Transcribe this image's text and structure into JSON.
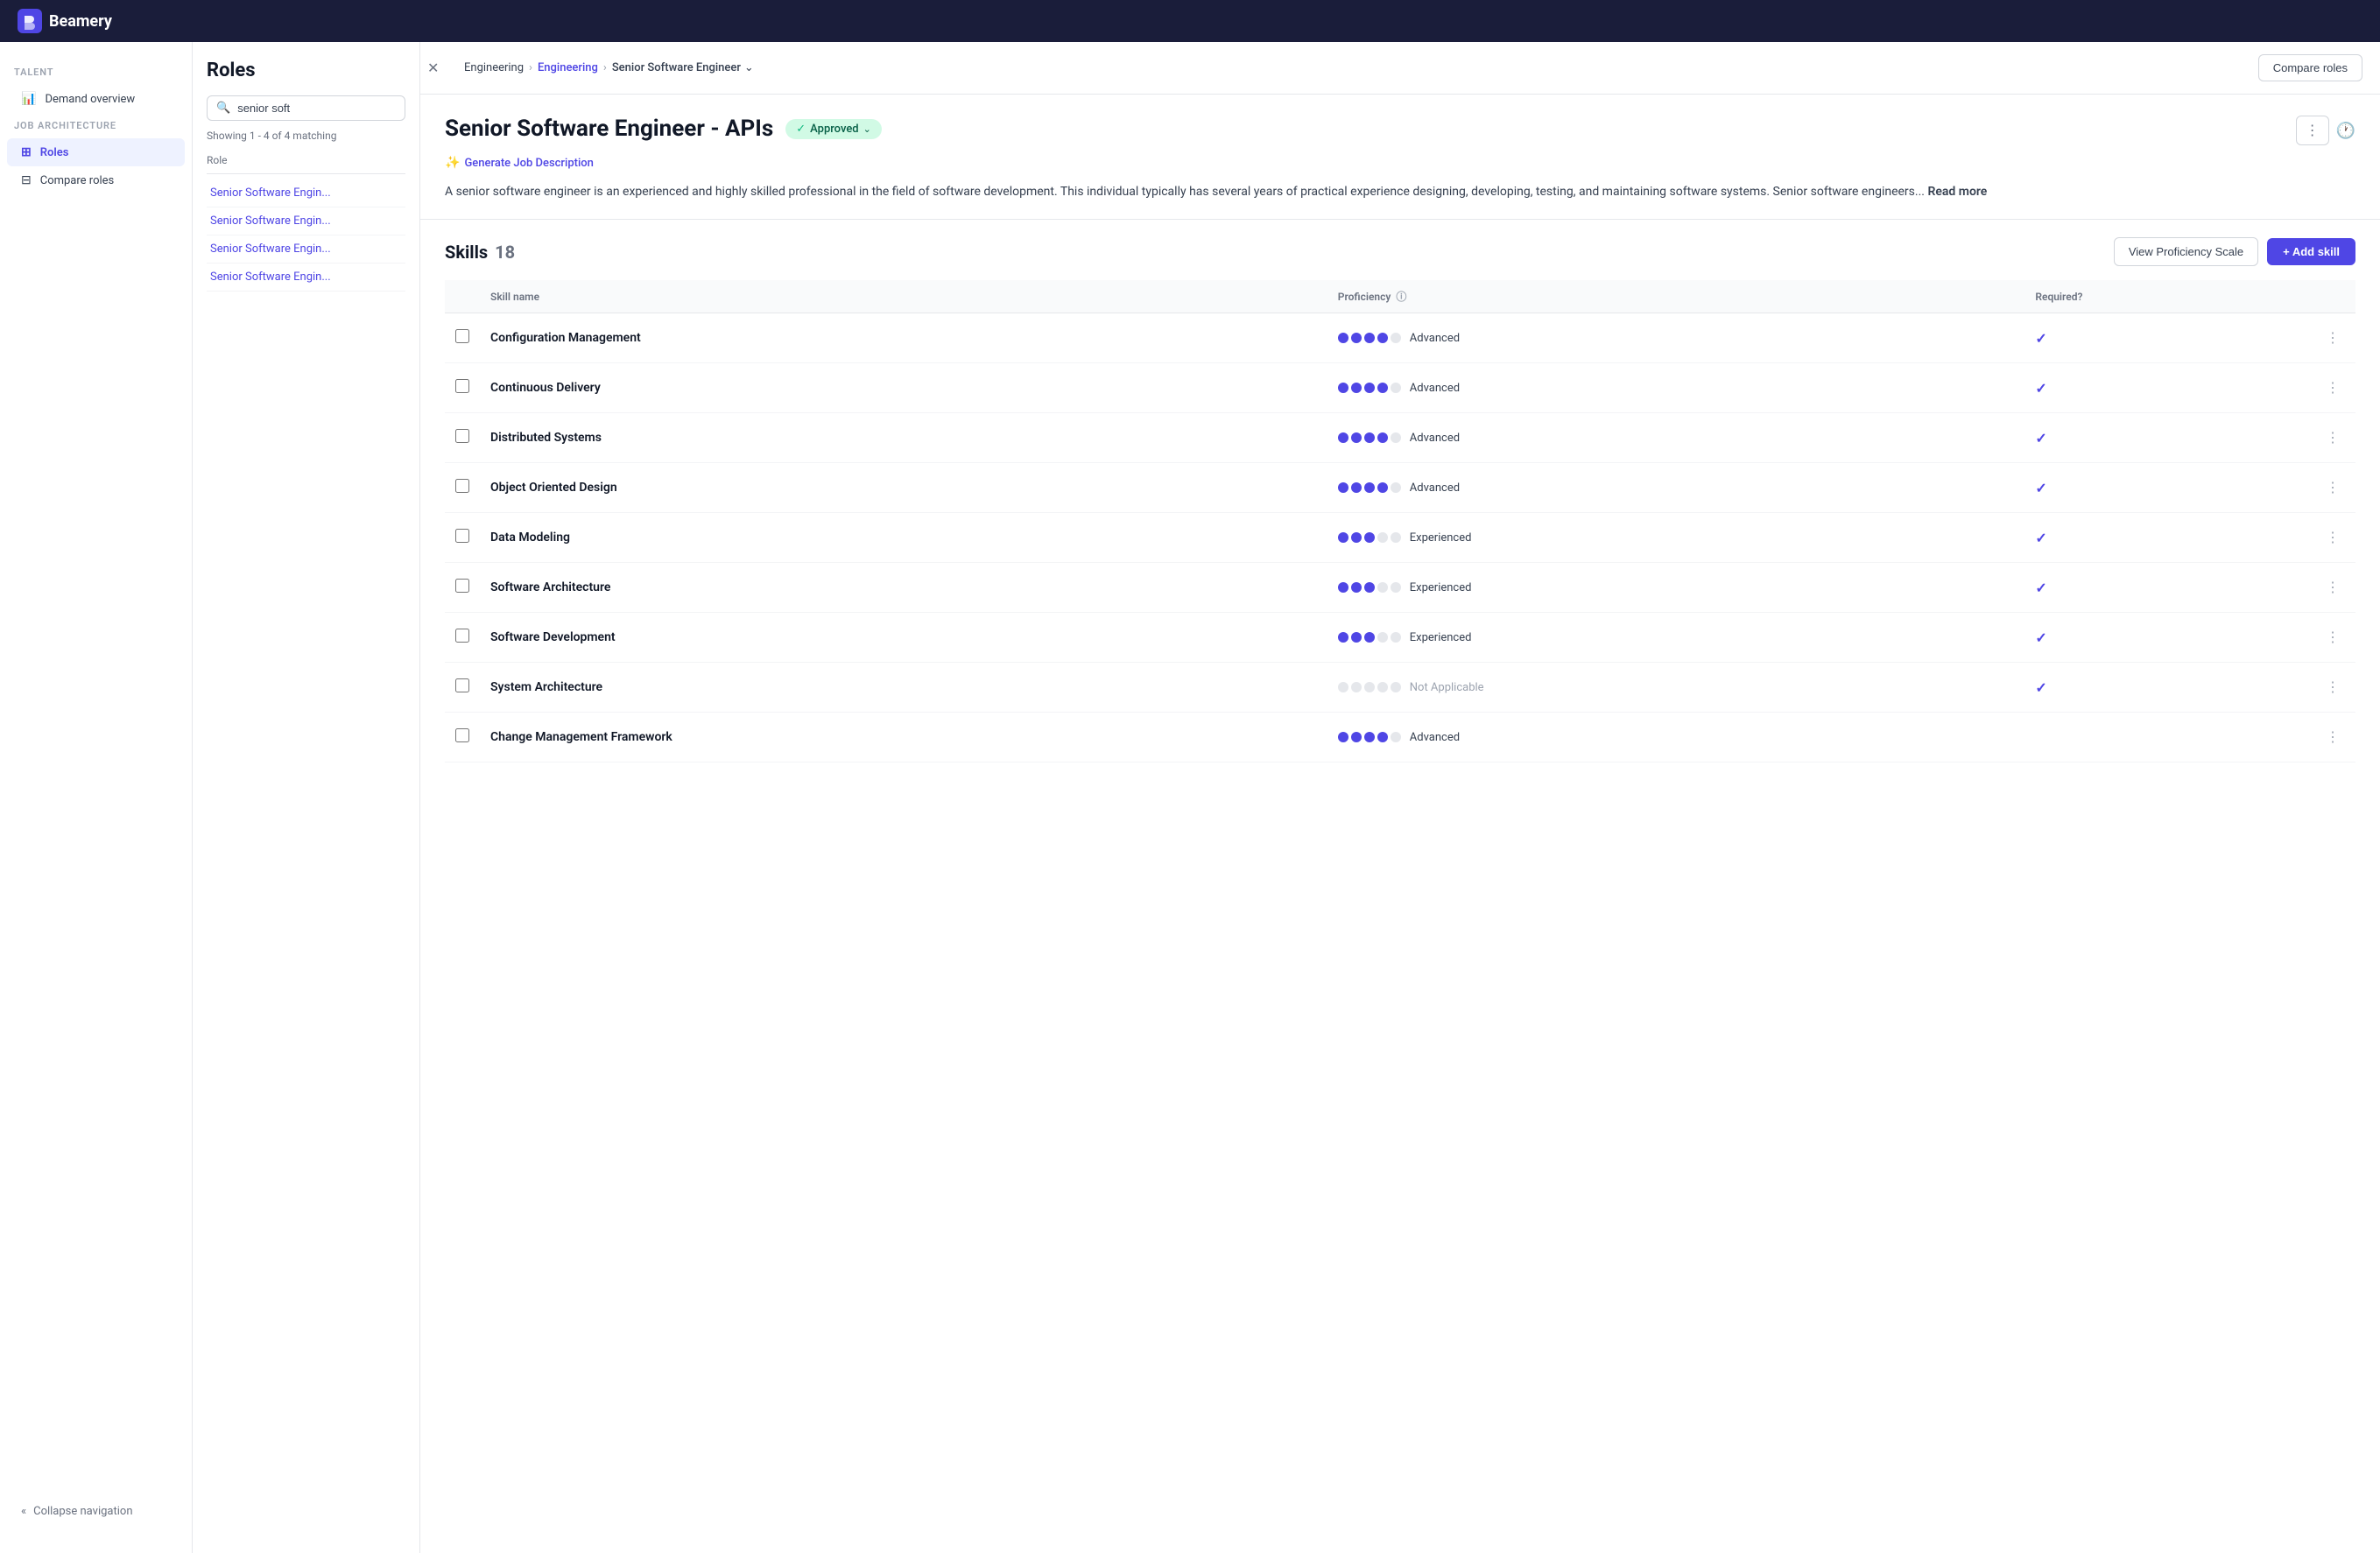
{
  "topnav": {
    "logo_text": "Beamery"
  },
  "sidebar": {
    "talent_label": "TALENT",
    "demand_overview_label": "Demand overview",
    "job_architecture_label": "JOB ARCHITECTURE",
    "roles_label": "Roles",
    "compare_roles_label": "Compare roles",
    "collapse_label": "Collapse navigation"
  },
  "roles_panel": {
    "title": "Roles",
    "search_placeholder": "senior soft",
    "search_value": "senior soft",
    "showing_text": "Showing 1 - 4 of 4 matching",
    "column_header": "Role",
    "items": [
      "Senior Software Engin...",
      "Senior Software Engin...",
      "Senior Software Engin...",
      "Senior Software Engin..."
    ]
  },
  "breadcrumb": {
    "part1": "Engineering",
    "part2": "Engineering",
    "part3": "Senior Software Engineer",
    "compare_roles": "Compare roles"
  },
  "detail": {
    "title": "Senior Software Engineer - APIs",
    "approved_label": "Approved",
    "generate_label": "Generate Job Description",
    "description": "A senior software engineer is an experienced and highly skilled professional in the field of software development. This individual typically has several years of practical experience designing, developing, testing, and maintaining software systems. Senior software engineers...",
    "read_more": "Read more",
    "skills_label": "Skills",
    "skills_count": "18",
    "view_proficiency": "View Proficiency Scale",
    "add_skill": "+ Add skill"
  },
  "skills_table": {
    "col_skill": "Skill name",
    "col_proficiency": "Proficiency",
    "col_required": "Required?",
    "rows": [
      {
        "name": "Configuration Management",
        "dots": [
          1,
          1,
          1,
          1,
          0
        ],
        "proficiency": "Advanced",
        "required": true
      },
      {
        "name": "Continuous Delivery",
        "dots": [
          1,
          1,
          1,
          1,
          0
        ],
        "proficiency": "Advanced",
        "required": true
      },
      {
        "name": "Distributed Systems",
        "dots": [
          1,
          1,
          1,
          1,
          0
        ],
        "proficiency": "Advanced",
        "required": true
      },
      {
        "name": "Object Oriented Design",
        "dots": [
          1,
          1,
          1,
          1,
          0
        ],
        "proficiency": "Advanced",
        "required": true
      },
      {
        "name": "Data Modeling",
        "dots": [
          1,
          1,
          1,
          0,
          0
        ],
        "proficiency": "Experienced",
        "required": true
      },
      {
        "name": "Software Architecture",
        "dots": [
          1,
          1,
          1,
          0,
          0
        ],
        "proficiency": "Experienced",
        "required": true
      },
      {
        "name": "Software Development",
        "dots": [
          1,
          1,
          1,
          0,
          0
        ],
        "proficiency": "Experienced",
        "required": true
      },
      {
        "name": "System Architecture",
        "dots": [
          0,
          0,
          0,
          0,
          0
        ],
        "proficiency": "Not Applicable",
        "required": true
      },
      {
        "name": "Change Management Framework",
        "dots": [
          1,
          1,
          1,
          1,
          0
        ],
        "proficiency": "Advanced",
        "required": false
      }
    ]
  }
}
